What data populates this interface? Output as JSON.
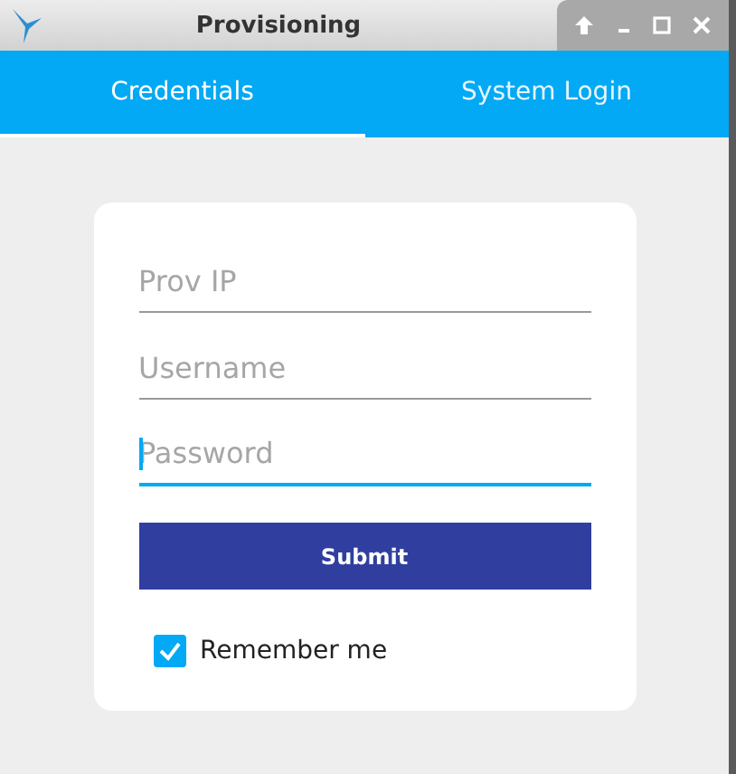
{
  "window": {
    "title": "Provisioning"
  },
  "tabs": [
    {
      "label": "Credentials",
      "selected": true
    },
    {
      "label": "System Login",
      "selected": false
    }
  ],
  "fields": [
    {
      "placeholder": "Prov IP",
      "focused": false
    },
    {
      "placeholder": "Username",
      "focused": false
    },
    {
      "placeholder": "Password",
      "focused": true
    }
  ],
  "submit": {
    "label": "Submit"
  },
  "remember": {
    "label": "Remember me",
    "checked": true
  }
}
